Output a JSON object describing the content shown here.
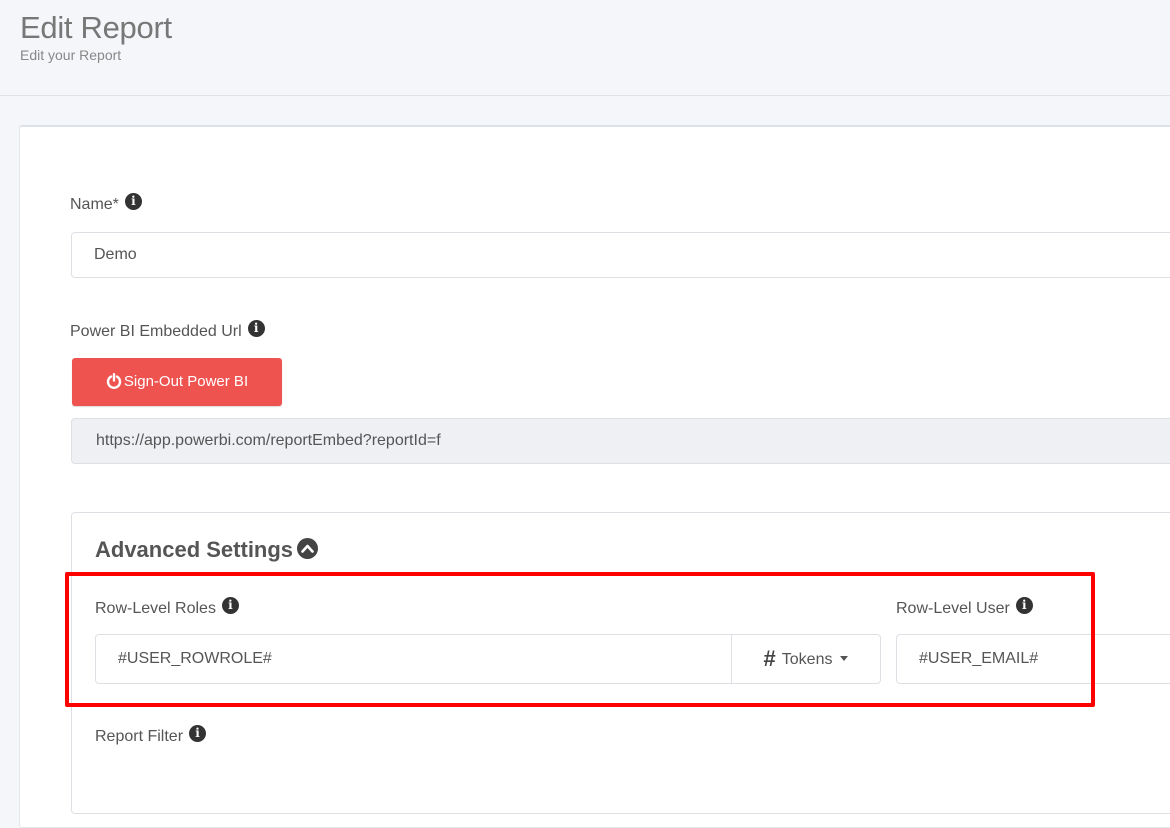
{
  "header": {
    "title": "Edit Report",
    "subtitle": "Edit your Report"
  },
  "form": {
    "name_label": "Name*",
    "name_value": "Demo",
    "url_label": "Power BI Embedded Url",
    "signout_label": "Sign-Out Power BI",
    "url_value": "https://app.powerbi.com/reportEmbed?reportId=f"
  },
  "advanced": {
    "title": "Advanced Settings",
    "row_roles_label": "Row-Level Roles",
    "row_roles_value": "#USER_ROWROLE#",
    "tokens_label": "Tokens",
    "row_user_label": "Row-Level User",
    "row_user_value": "#USER_EMAIL#",
    "report_filter_label": "Report Filter"
  },
  "colors": {
    "danger": "#ef5350",
    "highlight": "#ff0000",
    "background": "#f4f6f9"
  },
  "icons": [
    "info-icon",
    "power-icon",
    "chevron-up-icon",
    "hash-icon",
    "caret-down-icon"
  ]
}
